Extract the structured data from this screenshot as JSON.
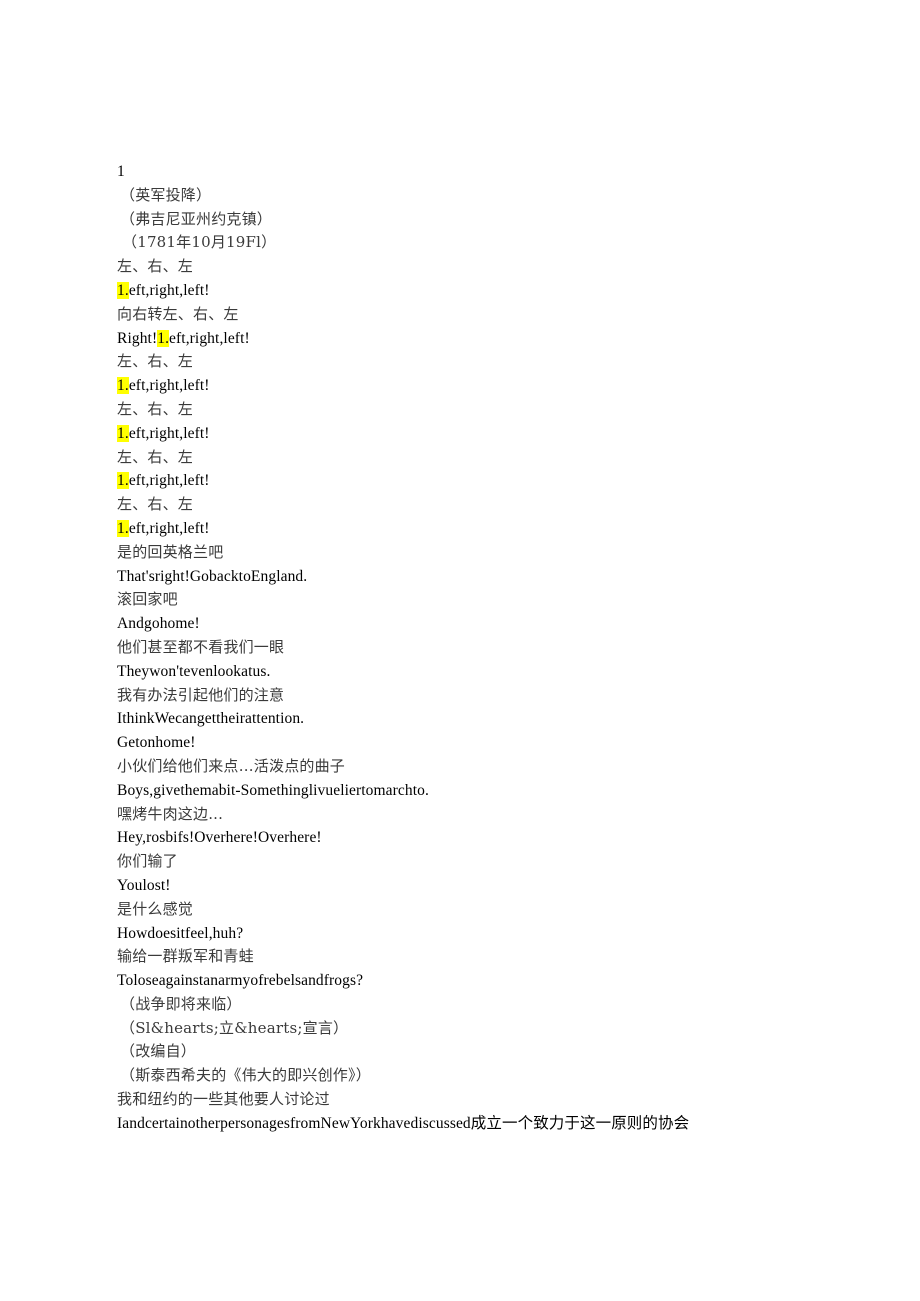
{
  "document": {
    "page_number": "1",
    "background_color": "#ffffff",
    "highlight_color": "#ffff00",
    "chinese_text_color": "#3a3a3a",
    "english_text_color": "#000000",
    "lines": [
      {
        "id": "page-number",
        "kind": "num",
        "text": "1"
      },
      {
        "id": "scene-heading-1",
        "kind": "zh paren",
        "text": "（英军投降）"
      },
      {
        "id": "scene-heading-2",
        "kind": "zh paren",
        "text": "（弗吉尼亚州约克镇）"
      },
      {
        "id": "scene-date",
        "kind": "zh paren-date",
        "text": "（1781年10月19Fl）"
      },
      {
        "id": "cadence-zh-1",
        "kind": "zh",
        "text": "左、右、左"
      },
      {
        "id": "cadence-en-1",
        "kind": "en",
        "pre_highlight": "",
        "highlight": "1.",
        "post_highlight": "eft,right,left!"
      },
      {
        "id": "cadence-zh-2",
        "kind": "zh",
        "text": "向右转左、右、左"
      },
      {
        "id": "cadence-en-2",
        "kind": "en",
        "pre_highlight": "Right!",
        "highlight": "1.",
        "post_highlight": "eft,right,left!"
      },
      {
        "id": "cadence-zh-3",
        "kind": "zh",
        "text": "左、右、左"
      },
      {
        "id": "cadence-en-3",
        "kind": "en",
        "pre_highlight": "",
        "highlight": "1.",
        "post_highlight": "eft,right,left!"
      },
      {
        "id": "cadence-zh-4",
        "kind": "zh",
        "text": "左、右、左"
      },
      {
        "id": "cadence-en-4",
        "kind": "en",
        "pre_highlight": "",
        "highlight": "1.",
        "post_highlight": "eft,right,left!"
      },
      {
        "id": "cadence-zh-5",
        "kind": "zh",
        "text": "左、右、左"
      },
      {
        "id": "cadence-en-5",
        "kind": "en",
        "pre_highlight": "",
        "highlight": "1.",
        "post_highlight": "eft,right,left!"
      },
      {
        "id": "cadence-zh-6",
        "kind": "zh",
        "text": "左、右、左"
      },
      {
        "id": "cadence-en-6",
        "kind": "en",
        "pre_highlight": "",
        "highlight": "1.",
        "post_highlight": "eft,right,left!"
      },
      {
        "id": "dialogue-zh-1",
        "kind": "zh",
        "text": "是的回英格兰吧"
      },
      {
        "id": "dialogue-en-1",
        "kind": "en",
        "text": "That'sright!GobacktoEngland."
      },
      {
        "id": "dialogue-zh-2",
        "kind": "zh",
        "text": "滚回家吧"
      },
      {
        "id": "dialogue-en-2",
        "kind": "en",
        "text": "Andgohome!"
      },
      {
        "id": "dialogue-zh-3",
        "kind": "zh",
        "text": "他们甚至都不看我们一眼"
      },
      {
        "id": "dialogue-en-3",
        "kind": "en",
        "text": "Theywon'tevenlookatus."
      },
      {
        "id": "dialogue-zh-4",
        "kind": "zh",
        "text": "我有办法引起他们的注意"
      },
      {
        "id": "dialogue-en-4",
        "kind": "en",
        "text": "IthinkWecangettheirattention."
      },
      {
        "id": "dialogue-en-5",
        "kind": "en",
        "text": "Getonhome!"
      },
      {
        "id": "dialogue-zh-5",
        "kind": "zh",
        "text": "小伙们给他们来点…活泼点的曲子"
      },
      {
        "id": "dialogue-en-6",
        "kind": "en",
        "text": "Boys,givethemabit-Somethinglivueliertomarchto."
      },
      {
        "id": "dialogue-zh-6",
        "kind": "zh",
        "text": "嘿烤牛肉这边..."
      },
      {
        "id": "dialogue-en-7",
        "kind": "en",
        "text": "Hey,rosbifs!Overhere!Overhere!"
      },
      {
        "id": "dialogue-zh-7",
        "kind": "zh",
        "text": "你们输了"
      },
      {
        "id": "dialogue-en-8",
        "kind": "en",
        "text": "Youlost!"
      },
      {
        "id": "dialogue-zh-8",
        "kind": "zh",
        "text": "是什么感觉"
      },
      {
        "id": "dialogue-en-9",
        "kind": "en",
        "text": "Howdoesitfeel,huh?"
      },
      {
        "id": "dialogue-zh-9",
        "kind": "zh",
        "text": "输给一群叛军和青蛙"
      },
      {
        "id": "dialogue-en-10",
        "kind": "en",
        "text": "Toloseagainstanarmyofrebelsandfrogs?"
      },
      {
        "id": "stage-note-1",
        "kind": "zh paren",
        "text": "（战争即将来临）"
      },
      {
        "id": "stage-note-2",
        "kind": "zh paren",
        "text": "（Sl&hearts;立&hearts;宣言）"
      },
      {
        "id": "stage-note-3",
        "kind": "zh paren",
        "text": "（改编自）"
      },
      {
        "id": "stage-note-4",
        "kind": "zh paren",
        "text": "（斯泰西希夫的《伟大的即兴创作》）"
      },
      {
        "id": "closing-zh",
        "kind": "zh",
        "text": "我和纽约的一些其他要人讨论过"
      },
      {
        "id": "closing-mixed",
        "kind": "en",
        "text": "IandcertainotherpersonagesfromNewYorkhavediscussed成立一个致力于这一原则的协会"
      }
    ]
  }
}
